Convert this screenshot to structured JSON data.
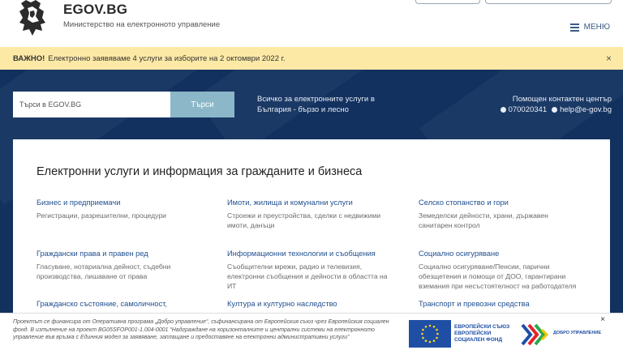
{
  "header": {
    "title": "EGOV.BG",
    "subtitle": "Министерство на електронното управление",
    "menu_label": "МЕНЮ"
  },
  "alert": {
    "bold": "ВАЖНО!",
    "text": "Електронно заявяваме 4 услуги за изборите на 2 октомври 2022 г.",
    "close": "×"
  },
  "search": {
    "placeholder": "Търси в EGOV.BG",
    "button_label": "Търси"
  },
  "tagline": "Всичко за електронните услуги в България - бързо и лесно",
  "contacts": {
    "title": "Помощен контактен център",
    "phone": "070020341",
    "email": "help@e-gov.bg"
  },
  "services": {
    "heading": "Електронни услуги и информация за гражданите и бизнеса",
    "categories": [
      {
        "title": "Бизнес и предприемачи",
        "desc": "Регистрации, разрешителни, процедури"
      },
      {
        "title": "Имоти, жилища и комунални услуги",
        "desc": "Строежи и преустройства, сделки с недвижими имоти, данъци"
      },
      {
        "title": "Селско стопанство и гори",
        "desc": "Земеделски дейности, храни, държавен санитарен контрол"
      },
      {
        "title": "Граждански права и правен ред",
        "desc": "Гласуване, нотариална дейност, съдебни производства, лишаване от права"
      },
      {
        "title": "Информационни технологии и съобщения",
        "desc": "Съобщителни мрежи, радио и телевизия, електронни съобщения и дейности в областта на ИТ"
      },
      {
        "title": "Социално осигуряване",
        "desc": "Социално осигуряване/Пенсии, парични обезщетения и помощи от ДОО, гарантирани вземания при несъстоятелност на работодателя"
      },
      {
        "title": "Гражданско състояние, самоличност,",
        "desc": ""
      },
      {
        "title": "Култура и културно наследство",
        "desc": ""
      },
      {
        "title": "Транспорт и превозни средства",
        "desc": ""
      }
    ]
  },
  "banner": {
    "text": "Проектът се финансира от Оперативна програма „Добро управление“, съфинансирана от Европейския съюз чрез Европейския социален фонд. В изпълнение на проект BG05SFOP001-1.004-0001 “Надграждане на хоризонталните и централни системи на електронното управление във връзка с Единния модел за заявяване, заплащане и предоставяне на електронни административни услуги”",
    "eu_line1": "ЕВРОПЕЙСКИ СЪЮЗ",
    "eu_line2": "ЕВРОПЕЙСКИ",
    "eu_line3": "СОЦИАЛЕН ФОНД",
    "gov_text": "ДОБРО УПРАВЛЕНИЕ",
    "close": "×"
  },
  "colors": {
    "hero": "#12315f",
    "alert": "#fde9a6",
    "link": "#1f4f8f",
    "search_button": "#8bb7c9"
  }
}
